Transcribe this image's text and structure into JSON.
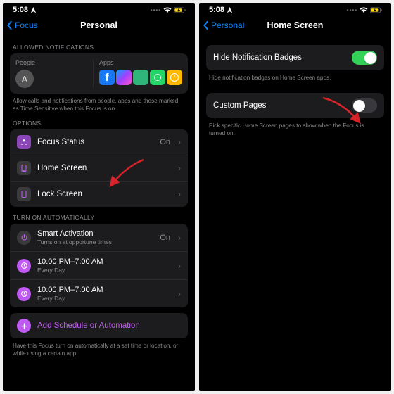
{
  "left": {
    "status": {
      "time": "5:08",
      "right_icons": "wifi battery"
    },
    "nav": {
      "back": "Focus",
      "title": "Personal"
    },
    "allowed": {
      "header": "ALLOWED NOTIFICATIONS",
      "people_label": "People",
      "people_avatar": "A",
      "apps_label": "Apps",
      "footer": "Allow calls and notifications from people, apps and those marked as Time Sensitive when this Focus is on."
    },
    "options": {
      "header": "OPTIONS",
      "items": [
        {
          "label": "Focus Status",
          "value": "On"
        },
        {
          "label": "Home Screen",
          "value": ""
        },
        {
          "label": "Lock Screen",
          "value": ""
        }
      ]
    },
    "auto": {
      "header": "TURN ON AUTOMATICALLY",
      "items": [
        {
          "main": "Smart Activation",
          "sub": "Turns on at opportune times",
          "value": "On"
        },
        {
          "main": "10:00 PM–7:00 AM",
          "sub": "Every Day",
          "value": ""
        },
        {
          "main": "10:00 PM–7:00 AM",
          "sub": "Every Day",
          "value": ""
        }
      ],
      "add": "Add Schedule or Automation",
      "footer": "Have this Focus turn on automatically at a set time or location, or while using a certain app."
    }
  },
  "right": {
    "status": {
      "time": "5:08"
    },
    "nav": {
      "back": "Personal",
      "title": "Home Screen"
    },
    "badges": {
      "label": "Hide Notification Badges",
      "footer": "Hide notification badges on Home Screen apps."
    },
    "custom": {
      "label": "Custom Pages",
      "footer": "Pick specific Home Screen pages to show when the Focus is turned on."
    }
  },
  "colors": {
    "fb": "#1877f2",
    "msg": "#a040ff",
    "wa": "#25d366",
    "clock": "#ffb800",
    "find": "#2fb57a"
  }
}
